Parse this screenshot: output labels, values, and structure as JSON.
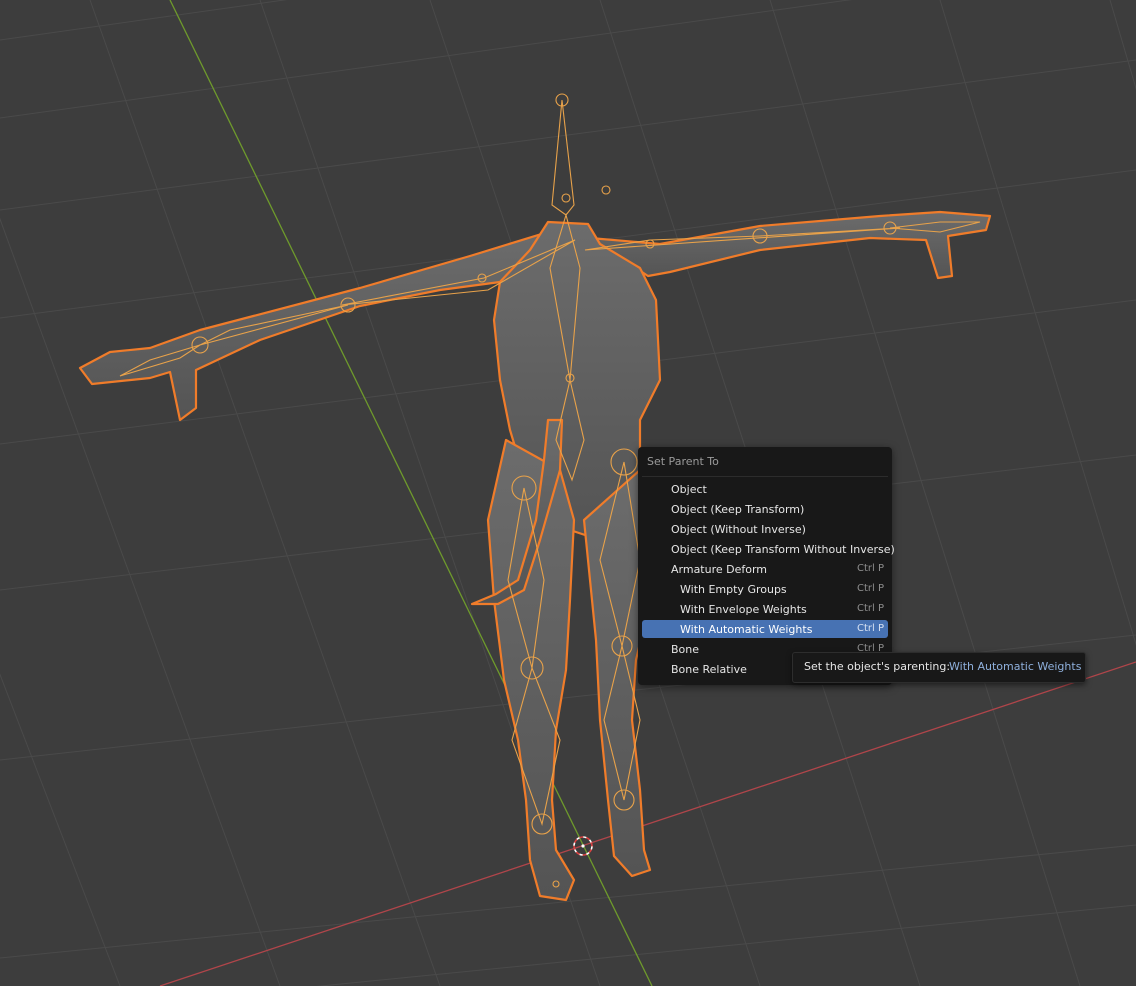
{
  "menu": {
    "title": "Set Parent To",
    "items": [
      {
        "label": "Object",
        "shortcut": ""
      },
      {
        "label": "Object (Keep Transform)",
        "shortcut": ""
      },
      {
        "label": "Object (Without Inverse)",
        "shortcut": ""
      },
      {
        "label": "Object (Keep Transform Without Inverse)",
        "shortcut": ""
      },
      {
        "label": "Armature Deform",
        "shortcut": "Ctrl P"
      },
      {
        "label": "With Empty Groups",
        "shortcut": "Ctrl P"
      },
      {
        "label": "With Envelope Weights",
        "shortcut": "Ctrl P"
      },
      {
        "label": "With Automatic Weights",
        "shortcut": "Ctrl P"
      },
      {
        "label": "Bone",
        "shortcut": "Ctrl P"
      },
      {
        "label": "Bone Relative",
        "shortcut": ""
      }
    ],
    "active_item": "With Automatic Weights"
  },
  "tooltip": {
    "text": "Set the object's parenting:",
    "value": "With Automatic Weights"
  },
  "colors": {
    "background": "#3d3d3d",
    "grid": "#4a4a4a",
    "x_axis": "#b0454a",
    "y_axis": "#6e9a2c",
    "selection_outline": "#f07c2a",
    "bone_outline": "#e8a24a",
    "menu_background": "#181818",
    "menu_highlight": "#4772b3"
  },
  "icons": [
    "3d-cursor-icon"
  ]
}
